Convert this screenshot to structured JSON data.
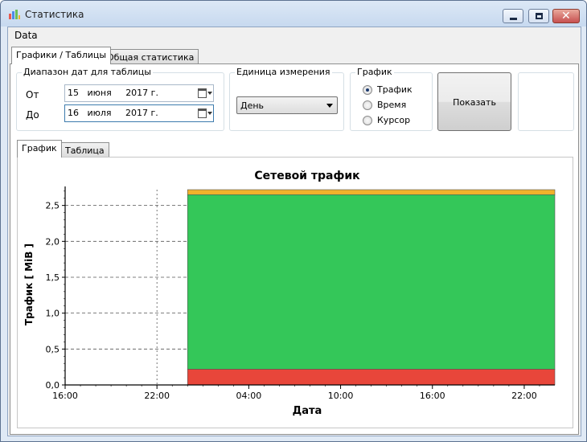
{
  "window": {
    "title": "Статистика"
  },
  "menu": {
    "items": [
      "Data"
    ]
  },
  "main_tabs": [
    "Графики / Таблицы",
    "Общая статистика"
  ],
  "date_range": {
    "title": "Диапазон дат для таблицы",
    "from_label": "От",
    "to_label": "До",
    "from_value": "15   июня     2017 г.",
    "to_value": "16   июля     2017 г."
  },
  "unit": {
    "title": "Единица измерения",
    "selected": "День"
  },
  "graph_group": {
    "title": "График",
    "options": [
      "Трафик",
      "Время",
      "Курсор"
    ],
    "selected_index": 0
  },
  "show_button": {
    "label": "Показать"
  },
  "sub_tabs": [
    "График",
    "Таблица"
  ],
  "colors": {
    "green": "#34c759",
    "red": "#e8463a",
    "orange": "#f2b22b",
    "selected_dot": "#1c3a6e"
  },
  "chart_data": {
    "type": "area",
    "title": "Сетевой трафик",
    "xlabel": "Дата",
    "ylabel": "Трафик [ MiB ]",
    "x_ticks": [
      "16:00",
      "22:00",
      "04:00",
      "10:00",
      "16:00",
      "22:00"
    ],
    "y_ticks": [
      "0,0",
      "0,5",
      "1,0",
      "1,5",
      "2,0",
      "2,5"
    ],
    "ylim": [
      0,
      2.72
    ],
    "x_range_hours": [
      0,
      32
    ],
    "fill_start_hour": 8,
    "fill_end_hour": 32,
    "series": [
      {
        "values": [
          0.22
        ],
        "color": "#e8463a"
      },
      {
        "values": [
          2.43
        ],
        "color": "#34c759"
      },
      {
        "values": [
          0.07
        ],
        "color": "#f2b22b"
      }
    ],
    "grid": true
  }
}
